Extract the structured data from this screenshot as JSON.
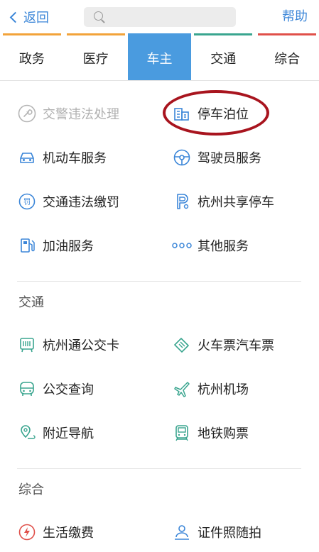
{
  "header": {
    "back_label": "返回",
    "search_placeholder": "",
    "help_label": "帮助"
  },
  "tabs": [
    {
      "label": "政务",
      "color": "#f2a33a",
      "active": false
    },
    {
      "label": "医疗",
      "color": "#f2a33a",
      "active": false
    },
    {
      "label": "车主",
      "color": "#4a9bdf",
      "active": true
    },
    {
      "label": "交通",
      "color": "#3aa58f",
      "active": false
    },
    {
      "label": "综合",
      "color": "#e0504a",
      "active": false
    }
  ],
  "car_owner": {
    "items": [
      {
        "label": "交警违法处理",
        "icon": "wrench-icon",
        "disabled": true
      },
      {
        "label": "停车泊位",
        "icon": "parking-building-icon",
        "disabled": false
      },
      {
        "label": "机动车服务",
        "icon": "car-icon",
        "disabled": false
      },
      {
        "label": "驾驶员服务",
        "icon": "steering-wheel-icon",
        "disabled": false
      },
      {
        "label": "交通违法缴罚",
        "icon": "fine-icon",
        "disabled": false
      },
      {
        "label": "杭州共享停车",
        "icon": "parking-p-icon",
        "disabled": false
      },
      {
        "label": "加油服务",
        "icon": "fuel-pump-icon",
        "disabled": false
      },
      {
        "label": "其他服务",
        "icon": "more-dots-icon",
        "disabled": false
      }
    ]
  },
  "traffic": {
    "title": "交通",
    "items": [
      {
        "label": "杭州通公交卡",
        "icon": "bus-card-icon"
      },
      {
        "label": "火车票汽车票",
        "icon": "ticket-icon"
      },
      {
        "label": "公交查询",
        "icon": "bus-icon"
      },
      {
        "label": "杭州机场",
        "icon": "airplane-icon"
      },
      {
        "label": "附近导航",
        "icon": "map-pin-icon"
      },
      {
        "label": "地铁购票",
        "icon": "metro-icon"
      }
    ]
  },
  "general": {
    "title": "综合",
    "items": [
      {
        "label": "生活缴费",
        "icon": "utility-bolt-icon"
      },
      {
        "label": "证件照随拍",
        "icon": "id-photo-icon"
      }
    ]
  },
  "colors": {
    "accent_blue": "#3b86d8",
    "icon_green": "#3aa58f",
    "icon_red": "#e0504a",
    "annotation": "#a8141e"
  }
}
